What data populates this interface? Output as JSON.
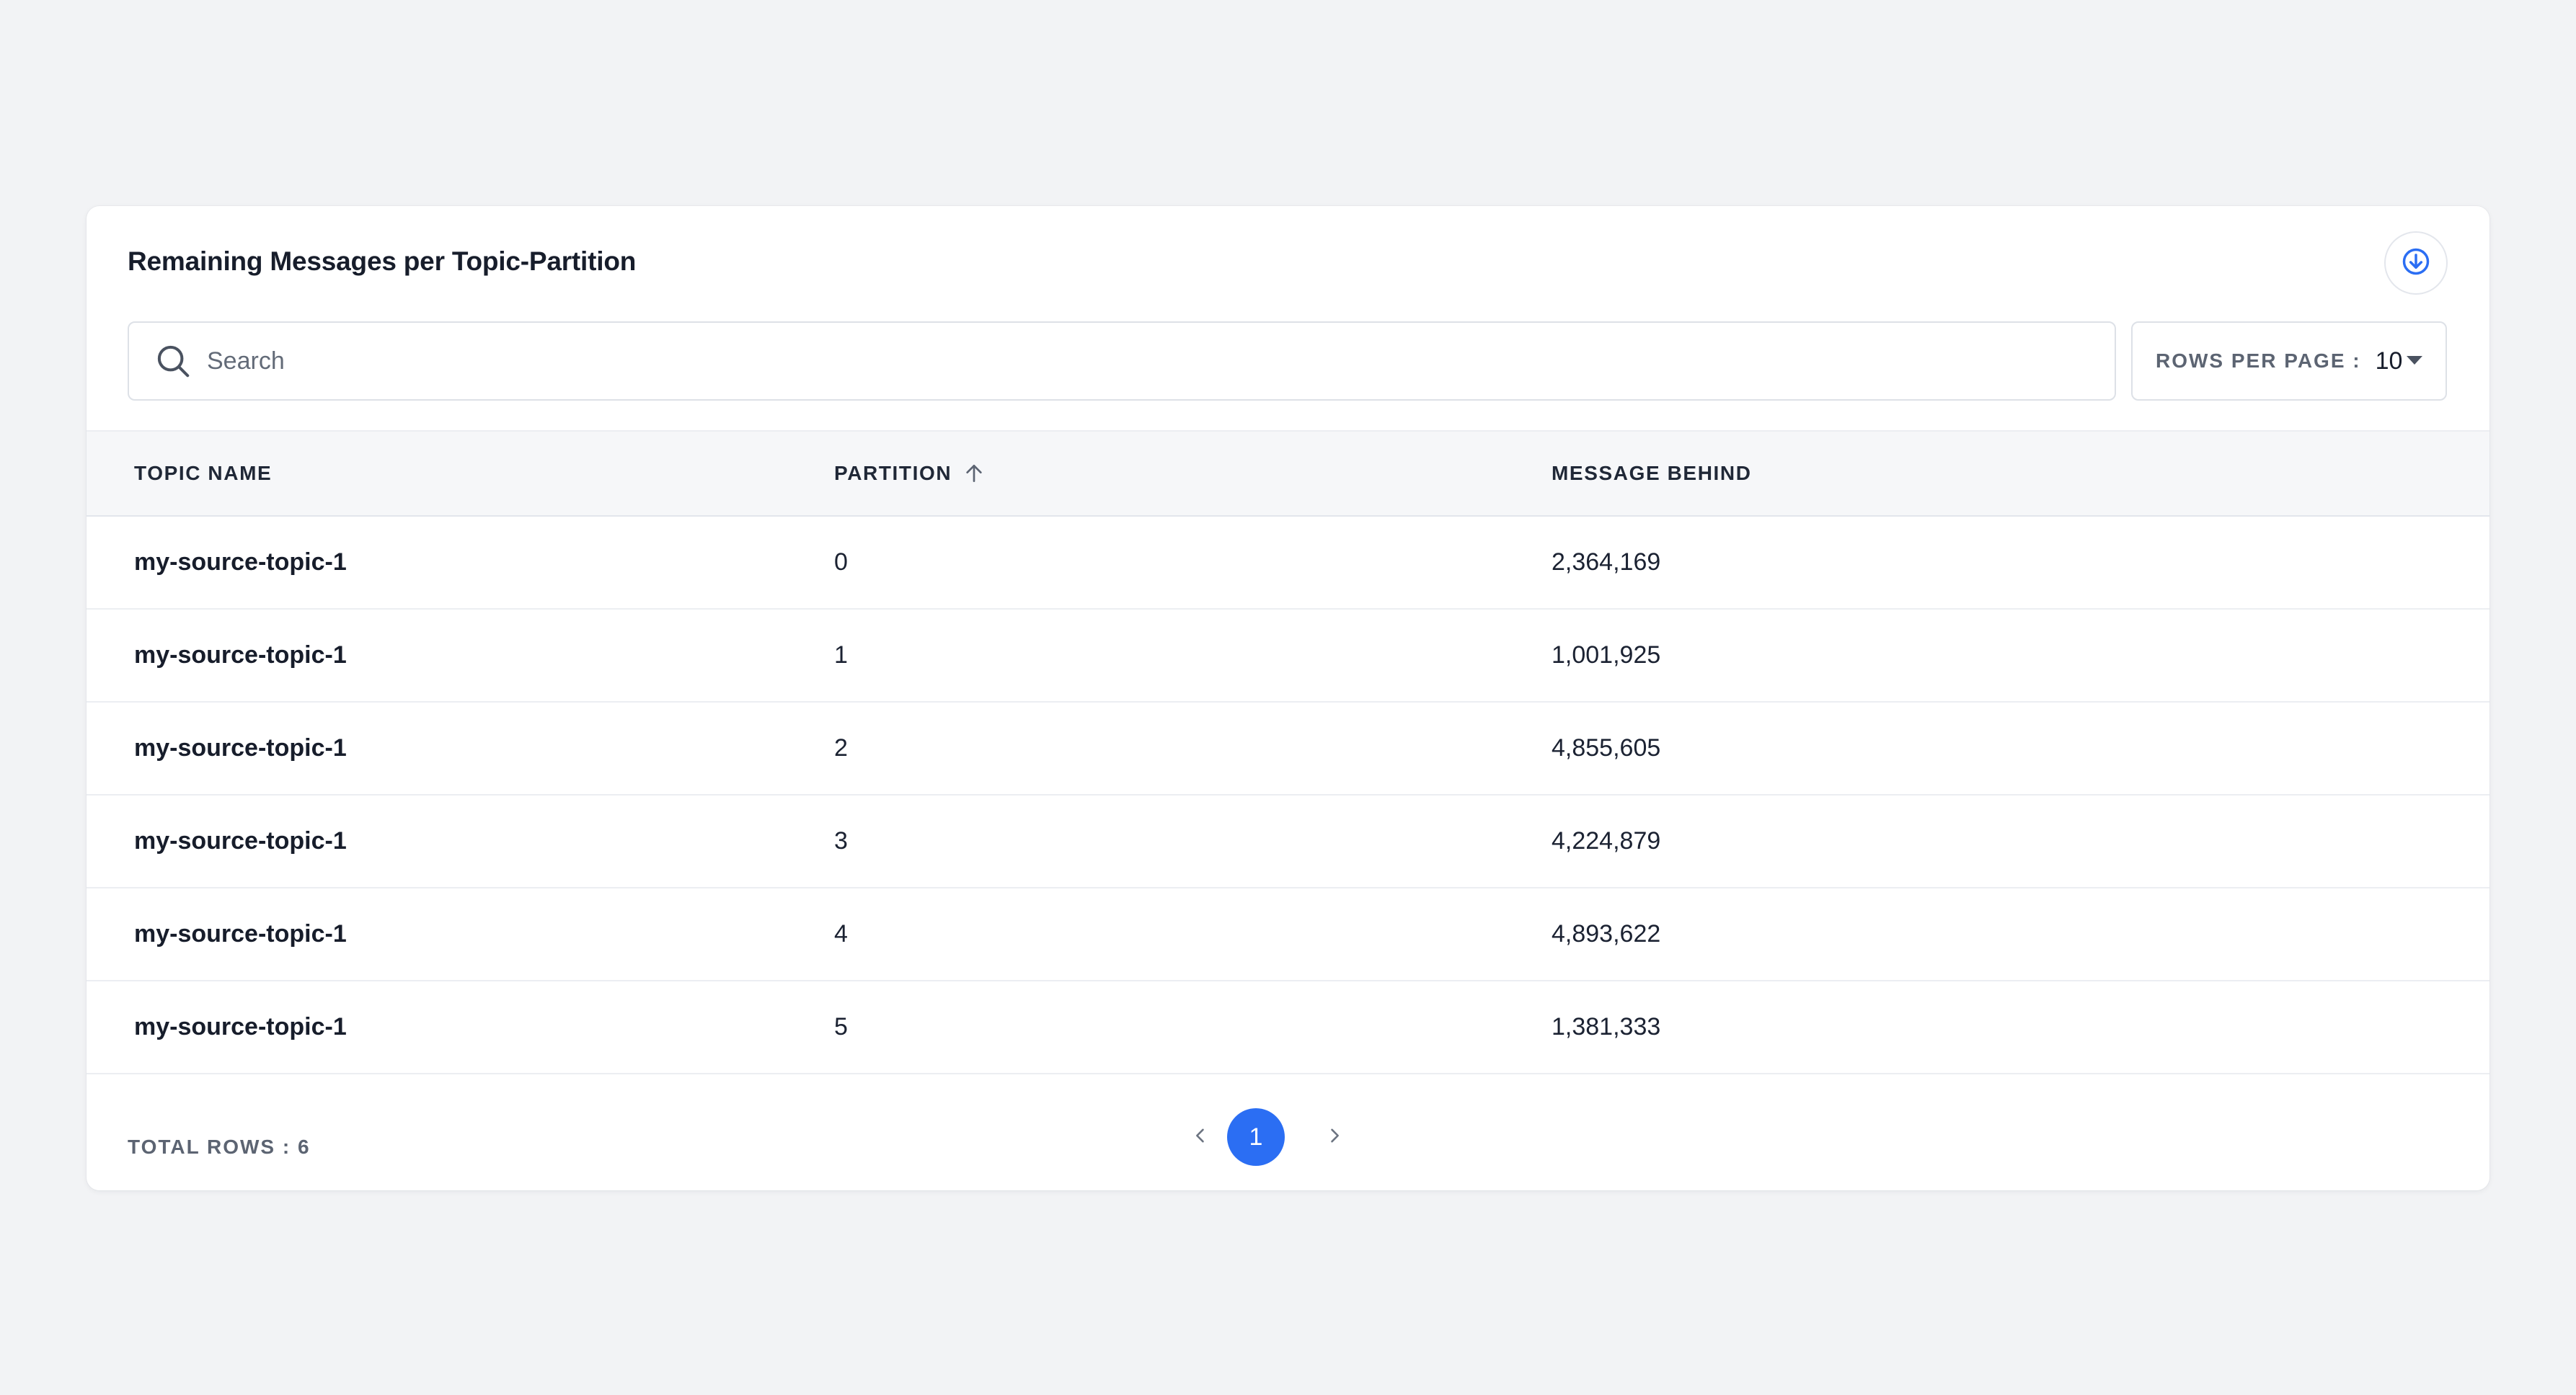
{
  "card": {
    "title": "Remaining Messages per Topic-Partition",
    "download_icon": "download-circle-icon"
  },
  "search": {
    "placeholder": "Search",
    "value": "",
    "icon": "search-icon"
  },
  "rows_per_page": {
    "label": "ROWS PER PAGE :",
    "value": "10",
    "icon": "caret-down-icon"
  },
  "table": {
    "columns": {
      "topic": "TOPIC NAME",
      "partition": "PARTITION",
      "message": "MESSAGE BEHIND"
    },
    "sort": {
      "column": "partition",
      "direction": "ascending",
      "icon": "arrow-up-icon"
    },
    "rows": [
      {
        "topic": "my-source-topic-1",
        "partition": "0",
        "message": "2,364,169"
      },
      {
        "topic": "my-source-topic-1",
        "partition": "1",
        "message": "1,001,925"
      },
      {
        "topic": "my-source-topic-1",
        "partition": "2",
        "message": "4,855,605"
      },
      {
        "topic": "my-source-topic-1",
        "partition": "3",
        "message": "4,224,879"
      },
      {
        "topic": "my-source-topic-1",
        "partition": "4",
        "message": "4,893,622"
      },
      {
        "topic": "my-source-topic-1",
        "partition": "5",
        "message": "1,381,333"
      }
    ]
  },
  "footer": {
    "total_rows": "TOTAL ROWS : 6"
  },
  "pagination": {
    "current_page": "1",
    "prev_icon": "chevron-left-icon",
    "next_icon": "chevron-right-icon"
  },
  "colors": {
    "accent": "#2b6ef3",
    "background": "#f2f3f5",
    "card": "#ffffff",
    "header_bg": "#f6f7f9"
  }
}
